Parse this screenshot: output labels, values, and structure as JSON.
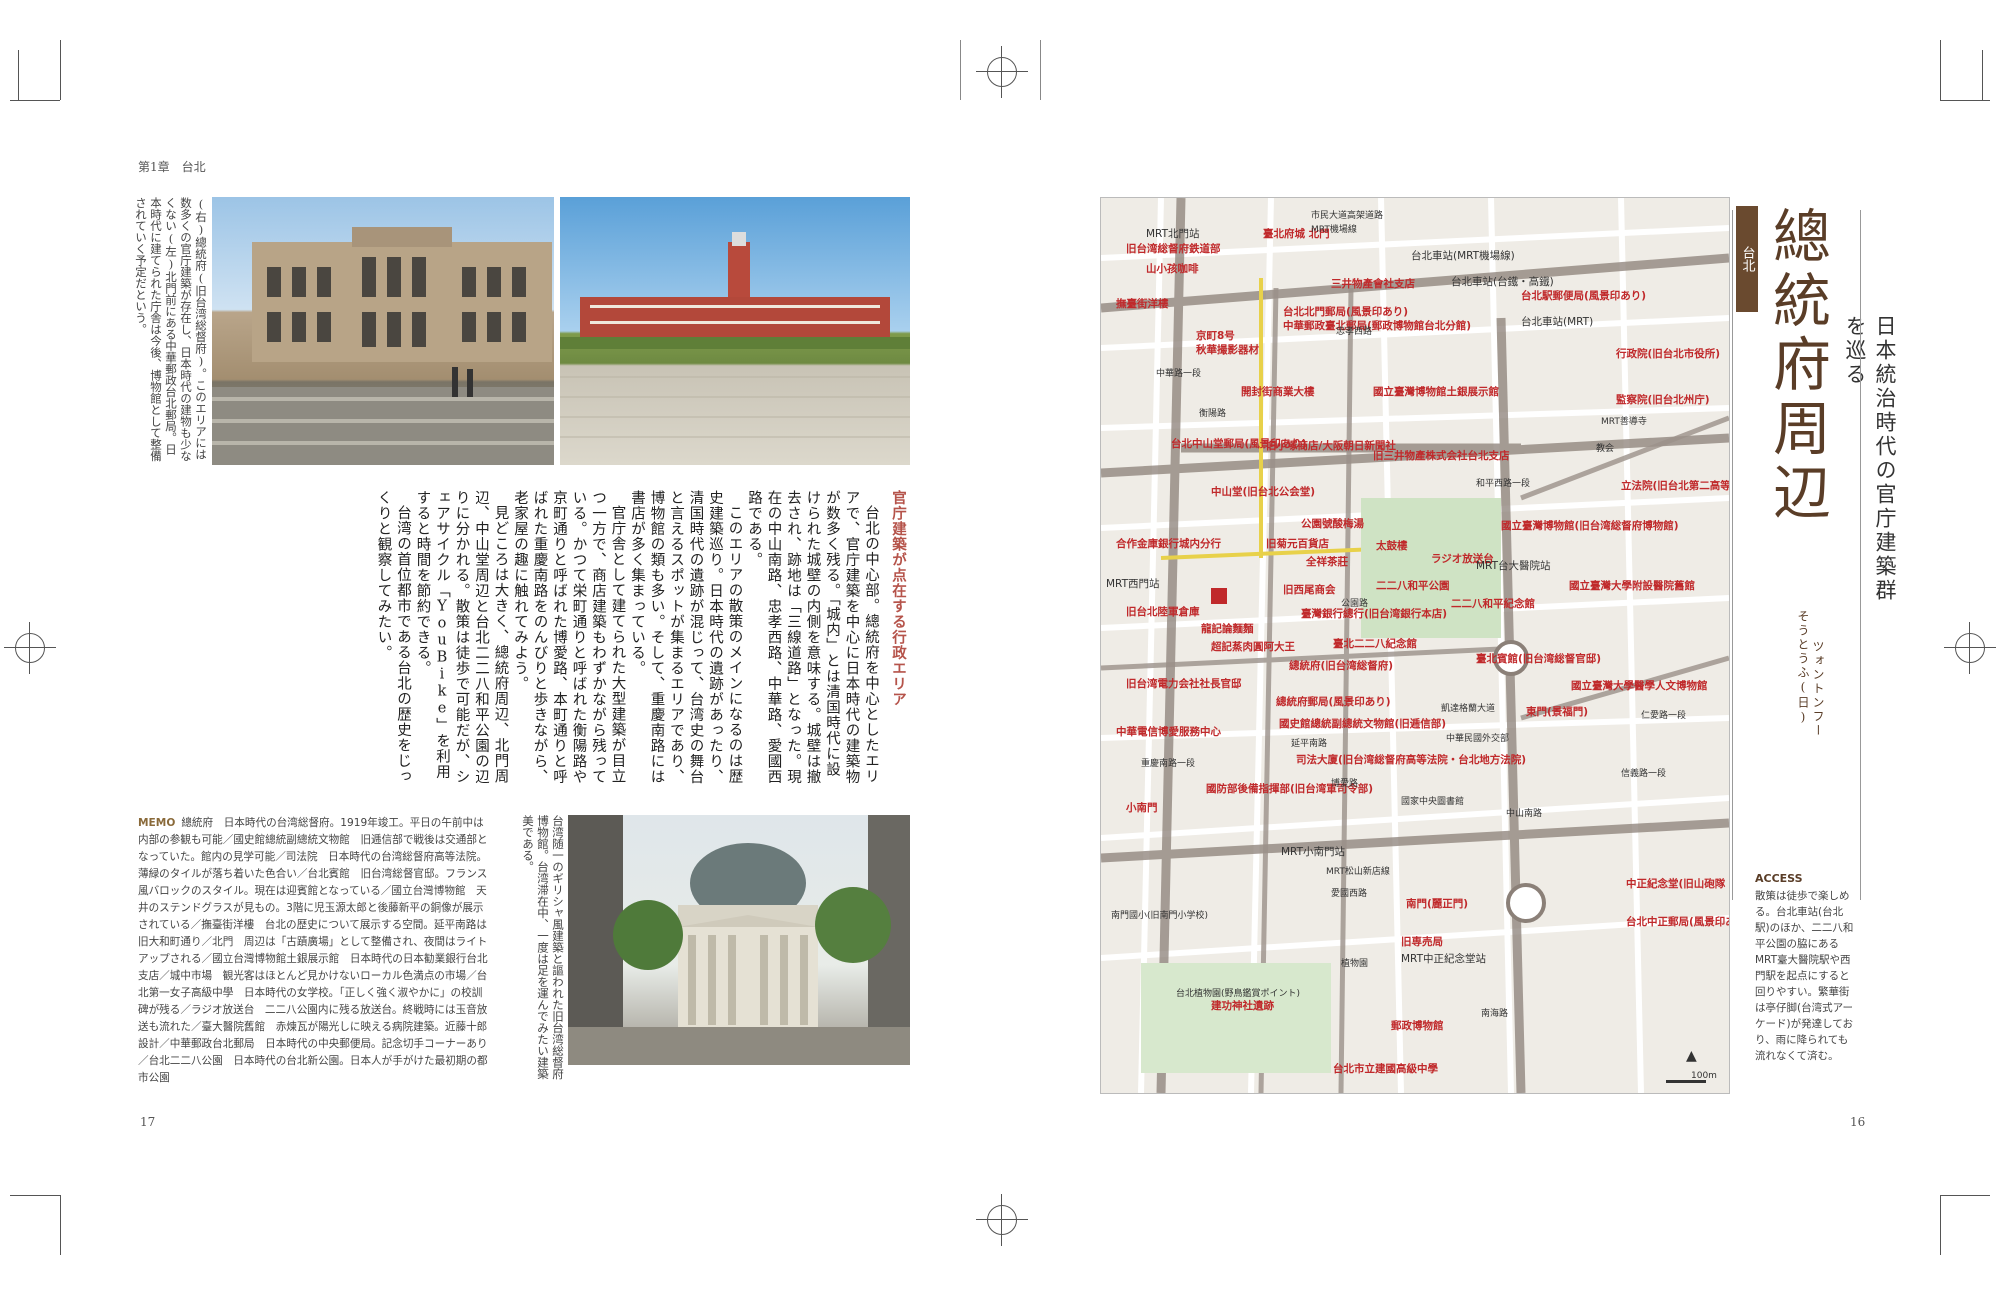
{
  "header": {
    "chapter": "第1章　台北",
    "page_left": "17",
    "page_right": "16"
  },
  "captions": {
    "top": "(右)總統府(旧台湾総督府)。このエリアには数多くの官庁建築が存在し、日本時代の建物も少なくない(左)北門前にある中華郵政台北郵局。日本時代に建てられた庁舎は今後、博物館として整備されていく予定だという。",
    "museum": "台湾随一のギリシャ風建築と謳われた旧台湾総督府博物館。台湾滞在中、一度は足を運んでみたい建築美である。"
  },
  "article": {
    "heading": "官庁建築が点在する行政エリア",
    "paragraphs": [
      "台北の中心部。總統府を中心としたエリアで、官庁建築を中心に日本時代の建築物が数多く残る。「城内」とは清国時代に設けられた城壁の内側を意味する。城壁は撤去され、跡地は「三線道路」となった。現在の中山南路、忠孝西路、中華路、愛國西路である。",
      "このエリアの散策のメインになるのは歴史建築巡り。日本時代の遺跡があったり、清国時代の遺跡が混じって、台湾史の舞台と言えるスポットが集まるエリアであり、博物館の類も多い。そして、重慶南路には書店が多く集まっている。",
      "官庁舎として建てられた大型建築が目立つ一方で、商店建築もわずかながら残っている。かつて栄町通りと呼ばれた衡陽路や京町通りと呼ばれた博愛路、本町通りと呼ばれた重慶南路をのんびりと歩きながら、老家屋の趣に触れてみよう。",
      "見どころは大きく、總統府周辺、北門周辺、中山堂周辺と台北二二八和平公園の辺りに分かれる。散策は徒歩で可能だが、シェアサイクル「YouBike」を利用すると時間を節約できる。",
      "台湾の首位都市である台北の歴史をじっくりと観察してみたい。"
    ]
  },
  "memo": {
    "label": "MEMO",
    "text": "總統府　日本時代の台湾総督府。1919年竣工。平日の午前中は内部の参観も可能／國史館總統副總統文物館　旧逓信部で戦後は交通部となっていた。館内の見学可能／司法院　日本時代の台湾総督府高等法院。薄緑のタイルが落ち着いた色合い／台北賓館　旧台湾総督官邸。フランス風バロックのスタイル。現在は迎賓館となっている／國立台灣博物館　天井のステンドグラスが見もの。3階に児玉源太郎と後藤新平の銅像が展示されている／撫臺街洋樓　台北の歴史について展示する空間。延平南路は旧大和町通り／北門　周辺は「古蹟廣場」として整備され、夜間はライトアップされる／國立台灣博物館土銀展示館　日本時代の日本勧業銀行台北支店／城中市場　観光客はほとんど見かけないローカル色満点の市場／台北第一女子高級中學　日本時代の女学校。「正しく強く淑やかに」の校訓碑が残る／ラジオ放送台　二二八公園内に残る放送台。終戦時には玉音放送も流れた／臺大醫院舊館　赤煉瓦が陽光しに映える病院建築。近藤十郎設計／中華郵政台北郵局　日本時代の中央郵便局。記念切手コーナーあり／台北二二八公園　日本時代の台北新公園。日本人が手がけた最初期の都市公園"
  },
  "sidebar": {
    "tag": "台北",
    "title": "總統府周辺",
    "subtitle": "日本統治時代の官庁建築群を巡る",
    "reading": "ツォントンフー",
    "reading2": "そうとうふ(日)",
    "access_label": "ACCESS",
    "access_text": "散策は徒歩で楽しめる。台北車站(台北駅)のほか、二二八和平公園の脇にあるMRT臺大醫院駅や西門駅を起点にすると回りやすい。繁華街は亭仔脚(台湾式アーケード)が発達しており、雨に降られても流れなくて済む。"
  },
  "map": {
    "labels_red": [
      "臺北府城 北門",
      "旧台湾総督府鉄道部",
      "山小孩咖啡",
      "三井物產會社支店",
      "撫臺街洋樓",
      "台北北門郵局(風景印あり)",
      "中華郵政臺北郵局(郵政博物館台北分館)",
      "京町8号",
      "秋華撮影器材",
      "台北駅郵便局(風景印あり)",
      "行政院(旧台北市役所)",
      "監察院(旧台北州庁)",
      "開封街商業大樓",
      "國立臺灣博物館土銀展示館",
      "台北中山堂郵局(風景印あり)",
      "旧小塚商店/大阪朝日新聞社",
      "旧三井物產株式会社台北支店",
      "中山堂(旧台北公会堂)",
      "立法院(旧台北第二高等女学校)",
      "公園號酸梅湯",
      "國立臺灣博物館(旧台湾総督府博物館)",
      "合作金庫銀行城内分行",
      "旧菊元百貨店",
      "全祥茶莊",
      "太鼓樓",
      "ラジオ放送台",
      "二二八和平公園",
      "二二八和平紀念館",
      "國立臺灣大學附設醫院舊館",
      "旧台北陸軍倉庫",
      "旧西尾商会",
      "臺灣銀行總行(旧台湾銀行本店)",
      "龍記論麵麵",
      "超記蒸肉圓阿大王",
      "臺北二二八紀念館",
      "臺北賓館(旧台湾総督官邸)",
      "總統府(旧台湾総督府)",
      "旧台湾電力会社社長官邸",
      "總統府郵局(風景印あり)",
      "國立臺灣大學醫學人文博物館",
      "中華電信博愛服務中心",
      "國史館總統副總統文物館(旧逓信部)",
      "東門(景福門)",
      "司法大廈(旧台湾総督府高等法院・台北地方法院)",
      "國防部後備指揮部(旧台湾軍司令部)",
      "小南門",
      "南門(麗正門)",
      "中正紀念堂(旧山砲隊・步兵第一聯隊)",
      "台北中正郵局(風景印あり)",
      "旧専売局",
      "建功神社遺跡",
      "郵政博物館",
      "台北市立建國高級中學"
    ],
    "labels_dark": [
      "MRT北門站",
      "市民大道高架道路",
      "MRT機場線",
      "台北車站(MRT機場線)",
      "台北車站(台鐵・高鐵)",
      "台北車站(MRT)",
      "MRT善導寺",
      "教会",
      "MRT台大醫院站",
      "MRT西門站",
      "MRT小南門站",
      "MRT松山新店線",
      "台北植物園(野鳥鑑賞ポイント)",
      "國家中央圖書館",
      "南門國小(旧南門小学校)",
      "MRT中正紀念堂站",
      "中華民國外交部",
      "愛國西路",
      "忠孝西路",
      "南海路",
      "仁愛路一段",
      "信義路一段",
      "凱達格蘭大道",
      "中山南路",
      "中華路一段",
      "重慶南路一段",
      "博愛路",
      "延平南路",
      "衡陽路",
      "公園路",
      "和平西路一段",
      "植物園",
      "100m"
    ]
  }
}
